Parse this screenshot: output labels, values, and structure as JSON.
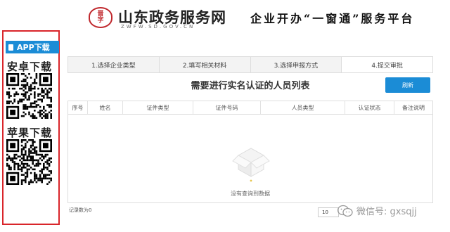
{
  "header": {
    "seal_text": "晋\n字",
    "site_title": "山东政务服务网",
    "site_url": "ZWFW.SD.GOV.CN",
    "slogan": "企业开办“一窗通”服务平台"
  },
  "sidebar": {
    "badge_label": "APP下载",
    "android_label": "安卓下载",
    "ios_label": "苹果下载"
  },
  "tabs": [
    {
      "label": "1.选择企业类型"
    },
    {
      "label": "2.填写相关材料"
    },
    {
      "label": "3.选择申报方式"
    },
    {
      "label": "4.提交审批"
    }
  ],
  "main": {
    "title": "需要进行实名认证的人员列表",
    "refresh_label": "刷新",
    "columns": [
      "序号",
      "姓名",
      "证件类型",
      "证件号码",
      "人员类型",
      "认证状态",
      "备注说明"
    ],
    "empty_text": "没有查询到数据",
    "record_count": "记录数为0",
    "page_size": "10"
  },
  "watermark": {
    "text": "微信号: gxsqjj"
  },
  "colors": {
    "accent_blue": "#1b8cd6",
    "frame_red": "#d9252a",
    "seal_red": "#c0282d"
  }
}
